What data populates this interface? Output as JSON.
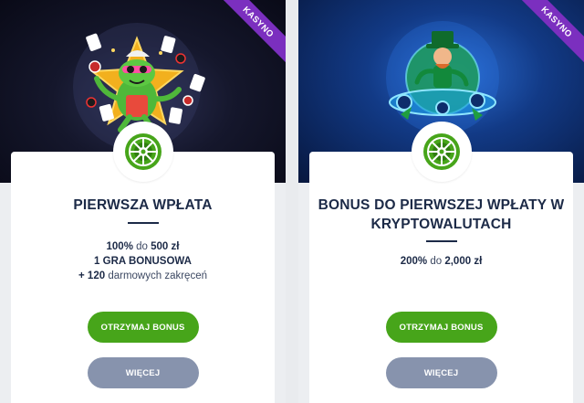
{
  "cards": [
    {
      "ribbon": "KASYNO",
      "title_line1": "PIERWSZA WPŁATA",
      "title_line2": "",
      "offer": {
        "line1_bold": "100%",
        "line1_mid": "do",
        "line1_amount": "500 zł",
        "line2": "1 GRA BONUSOWA",
        "line3_bold": "+ 120",
        "line3_rest": "darmowych zakręceń"
      },
      "primary_button": "OTRZYMAJ BONUS",
      "secondary_button": "WIĘCEJ",
      "hero_icon": "frog-casino-mascot-icon"
    },
    {
      "ribbon": "KASYNO",
      "title_line1": "BONUS DO PIERWSZEJ WPŁATY W",
      "title_line2": "KRYPTOWALUTACH",
      "offer": {
        "line1_bold": "200%",
        "line1_mid": "do",
        "line1_amount": "2,000 zł"
      },
      "primary_button": "OTRZYMAJ BONUS",
      "secondary_button": "WIĘCEJ",
      "hero_icon": "leprechaun-crypto-icon"
    }
  ],
  "colors": {
    "primary_button": "#47a51a",
    "secondary_button": "#8793ad",
    "ribbon": "#7b2fbf",
    "title": "#1c2a47",
    "badge_icon": "#47a51a"
  },
  "badge_icon": "roulette-wheel-icon"
}
